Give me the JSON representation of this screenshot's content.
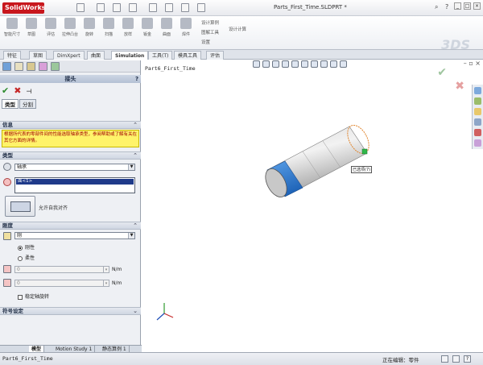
{
  "app": {
    "logo_text": "SolidWorks",
    "document_title": "Parts_First_Time.SLDPRT *"
  },
  "titlebar": {
    "search_icon": "search-icon",
    "help_label": "?"
  },
  "ribbon": {
    "buttons": [
      "智能尺寸",
      "草图",
      "评估",
      "拉伸凸台",
      "旋转",
      "扫描",
      "放样",
      "钣金",
      "曲面",
      "焊件"
    ],
    "small_items": [
      "设计算例",
      "图解工具",
      "设置"
    ],
    "calc_label": "设计计算",
    "watermark": "3DS"
  },
  "command_tabs": [
    "特征",
    "草图",
    "DimXpert",
    "曲面",
    "Simulation",
    "工具(T)",
    "模具工具",
    "评估"
  ],
  "active_command_tab": "Simulation",
  "property_manager": {
    "title": "接头",
    "help": "?",
    "tabs": [
      "类型",
      "分割"
    ],
    "message_header": "信息",
    "message_text": "根据所代表的零部件间的性能选取轴承类型，参阅帮助或了解有关在其它方面的详情。",
    "type_header": "类型",
    "type_value": "轴承",
    "selection_item": "面<1>",
    "flip_label": "允许自我对齐",
    "stiffness_header": "刚度",
    "stiffness_value": "刚",
    "radio_rigid": "刚性",
    "radio_flexible": "柔性",
    "spring_axial_value": "0",
    "spring_lateral_value": "0",
    "unit": "N/m",
    "stabilize_label": "稳定轴旋转",
    "symbol_header": "符号设定"
  },
  "bottom_tabs": [
    "模型",
    "Motion Study 1",
    "静态算例 1"
  ],
  "viewport": {
    "tree_label": "Part6_First_Time",
    "tooltip": "已选项(7)"
  },
  "status": {
    "left": "Part6_First_Time",
    "editing": "正在编辑：零件",
    "help": "?"
  },
  "colors": {
    "logo_red": "#c8171d",
    "selected_face": "#2f7fd6",
    "highlight_edge": "#e0832a",
    "message_yellow": "#fff36a"
  }
}
